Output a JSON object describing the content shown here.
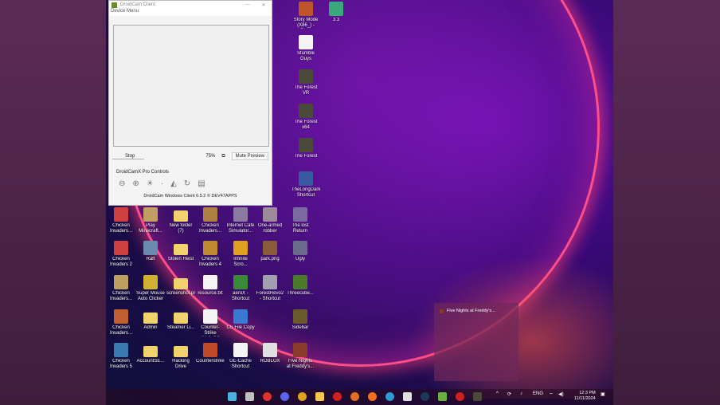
{
  "droidcam": {
    "title": "DroidCam Client",
    "menu": "Device Menu",
    "ip_field": "Stop",
    "zoom_pct": "75%",
    "mute_button": "Mute Preview",
    "pro_controls": "DroidCamX Pro Controls",
    "footer": "DroidCam Windows Client 6.5.2 © DEV47APPS",
    "minimize": "—",
    "close": "✕"
  },
  "desktop_icons": [
    {
      "label": "Story Mode (X86_) - Pla...",
      "kind": "app",
      "color": "#c0542a"
    },
    {
      "label": "3.3",
      "kind": "app",
      "color": "#3aa87a"
    },
    {
      "label": "Stumble Guys",
      "kind": "file",
      "color": "#f4f4f4"
    },
    {
      "label": "The Forest VR",
      "kind": "app",
      "color": "#4a4a3a"
    },
    {
      "label": "The Forest x64",
      "kind": "app",
      "color": "#4a4a3a"
    },
    {
      "label": "The Forest",
      "kind": "app",
      "color": "#4a4a3a"
    },
    {
      "label": "TheLongDark Shortcut",
      "kind": "app",
      "color": "#3a5aa0"
    },
    {
      "label": "Chicken Invaders...",
      "kind": "app",
      "color": "#d04040"
    },
    {
      "label": "Play Minecraft...",
      "kind": "app",
      "color": "#c0a060"
    },
    {
      "label": "New folder (7)",
      "kind": "folder",
      "color": "#f2d36b"
    },
    {
      "label": "Chicken Invaders...",
      "kind": "app",
      "color": "#b08040"
    },
    {
      "label": "Internet Cafe Simulator...",
      "kind": "app",
      "color": "#8a7aa0"
    },
    {
      "label": "One-armed robber",
      "kind": "app",
      "color": "#9a8a9a"
    },
    {
      "label": "The lost Return",
      "kind": "app",
      "color": "#7a6aa0"
    },
    {
      "label": "Chicken Invaders 2",
      "kind": "app",
      "color": "#d04040"
    },
    {
      "label": "Raft",
      "kind": "app",
      "color": "#6a8ab0"
    },
    {
      "label": "Stolen Heist",
      "kind": "folder",
      "color": "#f2d36b"
    },
    {
      "label": "Chicken Invaders 4",
      "kind": "app",
      "color": "#c08a30"
    },
    {
      "label": "Infinite Scro...",
      "kind": "app",
      "color": "#e0a020"
    },
    {
      "label": "park.png",
      "kind": "app",
      "color": "#8a5a3a"
    },
    {
      "label": "Ugly",
      "kind": "app",
      "color": "#6a6a8a"
    },
    {
      "label": "Chicken Invaders...",
      "kind": "app",
      "color": "#c0a060"
    },
    {
      "label": "Super Mouse Auto Clicker",
      "kind": "app",
      "color": "#d0b030"
    },
    {
      "label": "screenshot.png",
      "kind": "folder",
      "color": "#f2d36b"
    },
    {
      "label": "resource.txt",
      "kind": "file",
      "color": "#f4f4f4"
    },
    {
      "label": "aeroX - Shortcut",
      "kind": "app",
      "color": "#3a8a3a"
    },
    {
      "label": "ForestRevo2 - Shortcut",
      "kind": "app",
      "color": "#a0a0b0"
    },
    {
      "label": "Threecube...",
      "kind": "app",
      "color": "#4a7a2a"
    },
    {
      "label": "Chicken Invaders...",
      "kind": "app",
      "color": "#c06030"
    },
    {
      "label": "Admin",
      "kind": "folder",
      "color": "#f2d36b"
    },
    {
      "label": "Steamer Li...",
      "kind": "folder",
      "color": "#f2d36b"
    },
    {
      "label": "Counter-Strike WallsOff",
      "kind": "file",
      "color": "#f4f4f4"
    },
    {
      "label": "CS File Copy",
      "kind": "app",
      "color": "#3a7ad0"
    },
    {
      "label": "Sidebar",
      "kind": "app",
      "color": "#6a5a2a"
    },
    {
      "label": "Chicken Invaders 5",
      "kind": "app",
      "color": "#3a7ab0"
    },
    {
      "label": "AccountSE...",
      "kind": "folder",
      "color": "#f2d36b"
    },
    {
      "label": "Hacking Drive",
      "kind": "folder",
      "color": "#f2d36b"
    },
    {
      "label": "Counterstrike...",
      "kind": "app",
      "color": "#c04a2a"
    },
    {
      "label": "UE-Cache Shortcut",
      "kind": "file",
      "color": "#f4f4f4"
    },
    {
      "label": "ROBLOX",
      "kind": "app",
      "color": "#e0e0e0"
    },
    {
      "label": "Five Nights at Freddy's...",
      "kind": "app",
      "color": "#8a3a2a"
    }
  ],
  "notification": {
    "text": "Five Nights at Freddy's..."
  },
  "taskbar": {
    "apps": [
      {
        "name": "widgets",
        "color": "#4ab0e0"
      },
      {
        "name": "explorer-window",
        "color": "#c0c0c0"
      },
      {
        "name": "obs",
        "color": "#e03030"
      },
      {
        "name": "discord",
        "color": "#5865f2"
      },
      {
        "name": "chrome",
        "color": "#e0a020"
      },
      {
        "name": "file-explorer",
        "color": "#f2c94c"
      },
      {
        "name": "opera",
        "color": "#d02020"
      },
      {
        "name": "chrome-2",
        "color": "#e07020"
      },
      {
        "name": "firefox",
        "color": "#f07020"
      },
      {
        "name": "edge",
        "color": "#2a9ad0"
      },
      {
        "name": "roblox",
        "color": "#e0e0e0"
      },
      {
        "name": "steam",
        "color": "#1a3a5a"
      },
      {
        "name": "android-studio",
        "color": "#6ab040"
      },
      {
        "name": "red-app",
        "color": "#d02020"
      },
      {
        "name": "game",
        "color": "#4a4a3a"
      }
    ],
    "language": "ENG",
    "time": "12:3 PM",
    "date": "11/11/2024"
  }
}
